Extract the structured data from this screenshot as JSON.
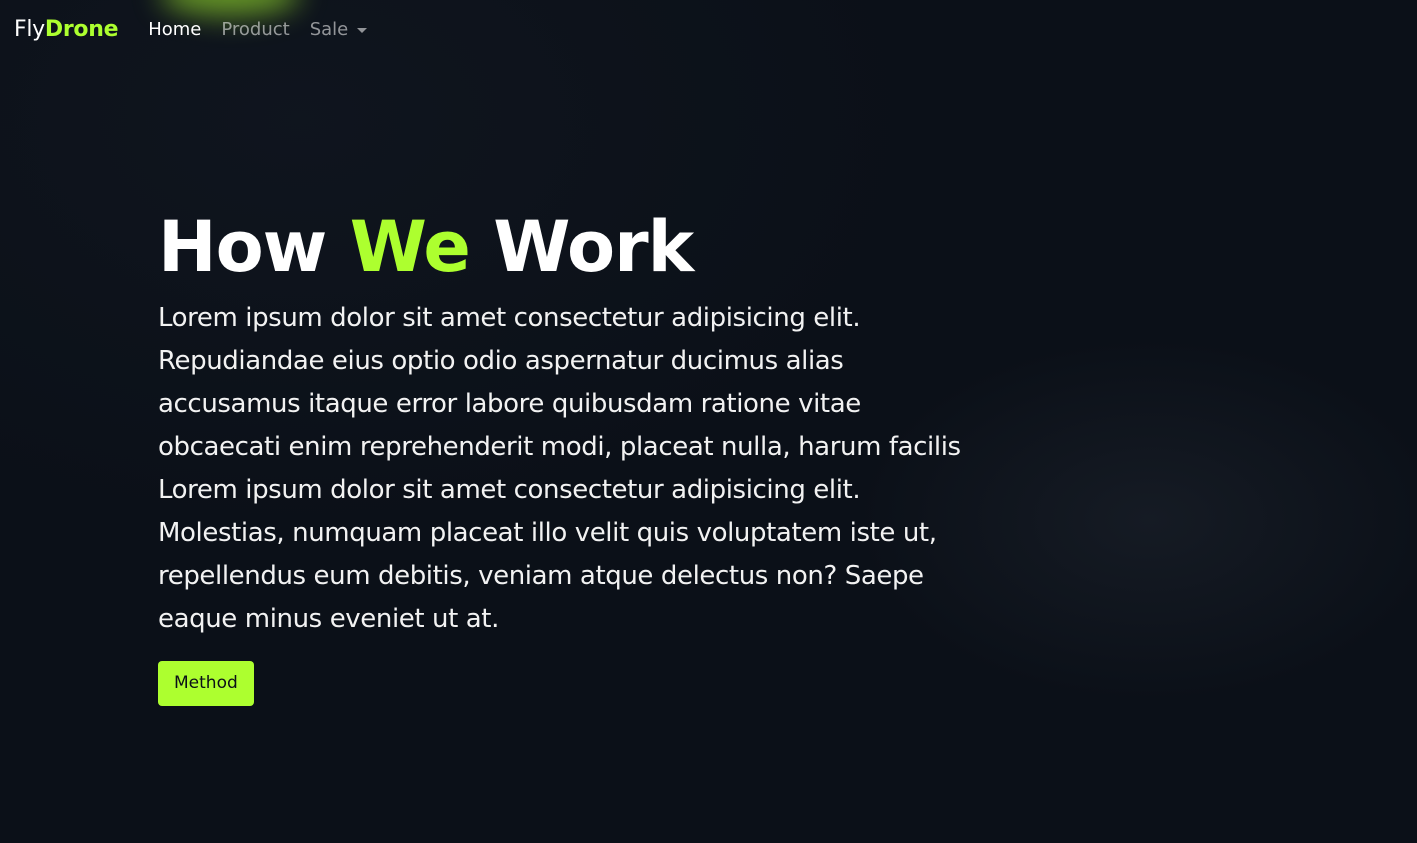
{
  "navbar": {
    "brand": {
      "prefix": "Fly",
      "accent": "Drone"
    },
    "links": [
      {
        "label": "Home",
        "active": true
      },
      {
        "label": "Product",
        "active": false
      },
      {
        "label": "Sale",
        "active": false,
        "dropdown": true
      }
    ]
  },
  "hero": {
    "title": {
      "before": "How ",
      "accent": "We",
      "after": " Work"
    },
    "text": "Lorem ipsum dolor sit amet consectetur adipisicing elit. Repudiandae eius optio odio aspernatur ducimus alias accusamus itaque error labore quibusdam ratione vitae obcaecati enim reprehenderit modi, placeat nulla, harum facilis Lorem ipsum dolor sit amet consectetur adipisicing elit. Molestias, numquam placeat illo velit quis voluptatem iste ut, repellendus eum debitis, veniam atque delectus non? Saepe eaque minus eveniet ut at.",
    "button_label": "Method"
  },
  "colors": {
    "accent": "#adff2f",
    "background": "#0b1018",
    "text": "#ffffff"
  },
  "icons": {
    "dropdown": "caret-down-icon"
  }
}
